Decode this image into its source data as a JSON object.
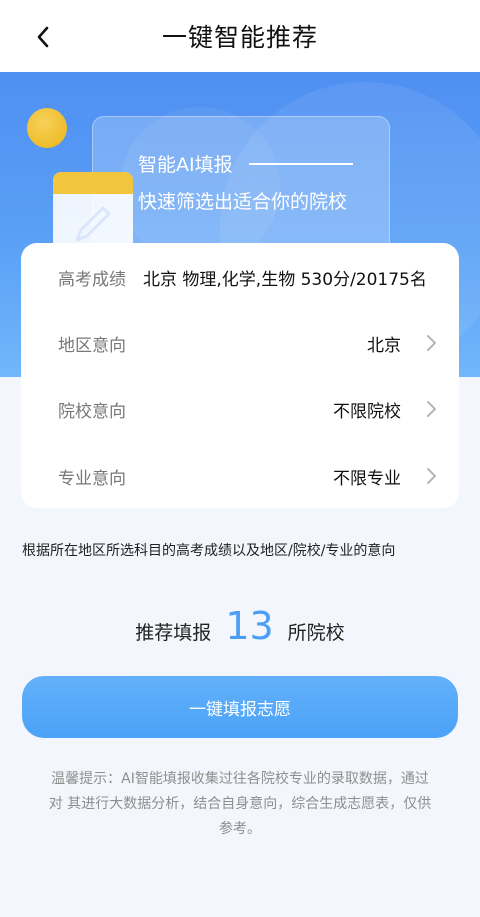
{
  "header": {
    "title": "一键智能推荐"
  },
  "hero": {
    "line1": "智能AI填报",
    "line2": "快速筛选出适合你的院校"
  },
  "info": {
    "score": {
      "label": "高考成绩",
      "value": "北京 物理,化学,生物 530分/20175名"
    },
    "region": {
      "label": "地区意向",
      "value": "北京"
    },
    "school": {
      "label": "院校意向",
      "value": "不限院校"
    },
    "major": {
      "label": "专业意向",
      "value": "不限专业"
    }
  },
  "description": "根据所在地区所选科目的高考成绩以及地区/院校/专业的意向",
  "recommend": {
    "prefix": "推荐填报",
    "count": "13",
    "suffix": "所院校"
  },
  "cta": {
    "label": "一键填报志愿"
  },
  "tip": {
    "line1": "温馨提示：AI智能填报收集过往各院校专业的录取数据，通过",
    "line2": "对 其进行大数据分析，结合自身意向，综合生成志愿表，仅供",
    "line3": "参考。"
  },
  "colors": {
    "accent": "#4b9ef5",
    "hero": "#4f8ff2",
    "sun": "#f0c233"
  }
}
